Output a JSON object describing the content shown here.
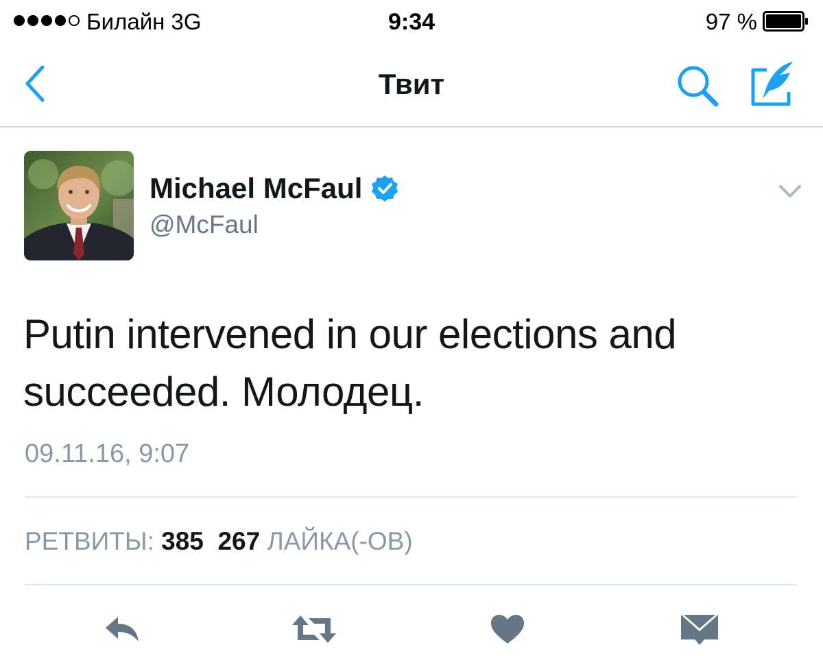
{
  "status_bar": {
    "carrier": "Билайн   3G",
    "time": "9:34",
    "battery_percent": "97 %"
  },
  "nav": {
    "title": "Твит",
    "icons": {
      "back": "chevron-left-icon",
      "search": "search-icon",
      "compose": "compose-tweet-icon"
    },
    "accent_color": "#1da1f2"
  },
  "tweet": {
    "author_name": "Michael McFaul",
    "author_handle": "@McFaul",
    "verified": true,
    "text": "Putin intervened in our elections and succeeded. Молодец.",
    "timestamp": "09.11.16, 9:07"
  },
  "stats": {
    "retweets_label": "РЕТВИТЫ:",
    "retweets_count": "385",
    "likes_count": "267",
    "likes_label": "ЛАЙКА(-ОВ)"
  },
  "actions": {
    "icons": [
      "reply-icon",
      "retweet-icon",
      "like-heart-icon",
      "direct-message-icon"
    ],
    "icon_color": "#657786"
  }
}
